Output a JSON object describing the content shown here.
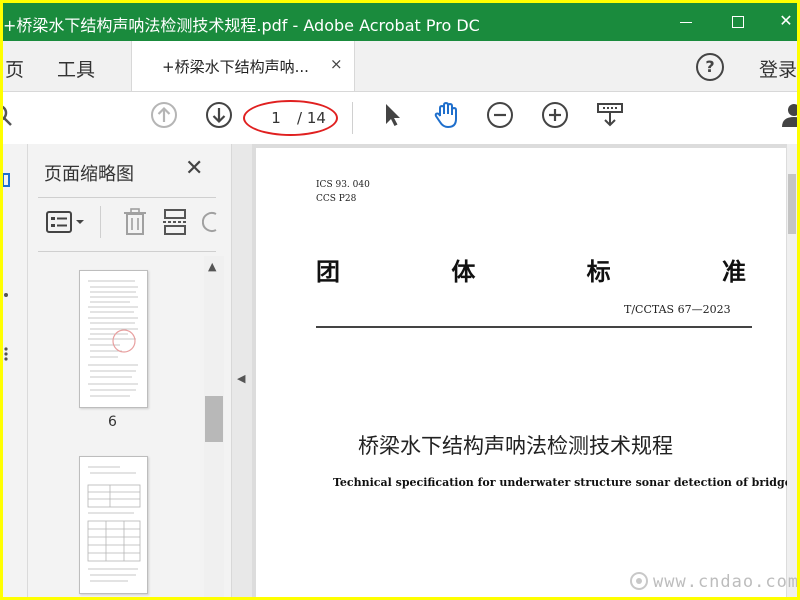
{
  "window": {
    "title": "+桥梁水下结构声呐法检测技术规程.pdf - Adobe Acrobat Pro DC",
    "controls": [
      "minimize-icon",
      "maximize-icon",
      "close-icon"
    ]
  },
  "tabs": {
    "home_partial": "页",
    "tools": "工具",
    "document_tab": "+桥梁水下结构声呐...",
    "close_symbol": "×",
    "help_symbol": "?",
    "login": "登录"
  },
  "toolbar": {
    "icons": [
      "prev-page-icon",
      "next-page-icon",
      "select-arrow-icon",
      "hand-tool-icon",
      "zoom-out-icon",
      "zoom-in-icon",
      "scroll-mode-icon"
    ],
    "current_page": "1",
    "total_pages": "/ 14"
  },
  "thumbnail_panel": {
    "title": "页面缩略图",
    "close_symbol": "✕",
    "pages": [
      {
        "number": "6"
      },
      {
        "number": ""
      }
    ]
  },
  "document": {
    "ics": "ICS 93. 040",
    "ccs": "CCS P28",
    "standard_type": [
      "团",
      "体",
      "标",
      "准"
    ],
    "standard_code": "T/CCTAS 67—2023",
    "title_cn": "桥梁水下结构声呐法检测技术规程",
    "title_en": "Technical specification for underwater structure sonar detection of bridges"
  },
  "watermark": "www.cndao.com",
  "colors": {
    "titlebar": "#1a8b3d",
    "border": "#ffff00",
    "hand_tool": "#1f6fcc",
    "annotation_ellipse": "#e02020"
  }
}
